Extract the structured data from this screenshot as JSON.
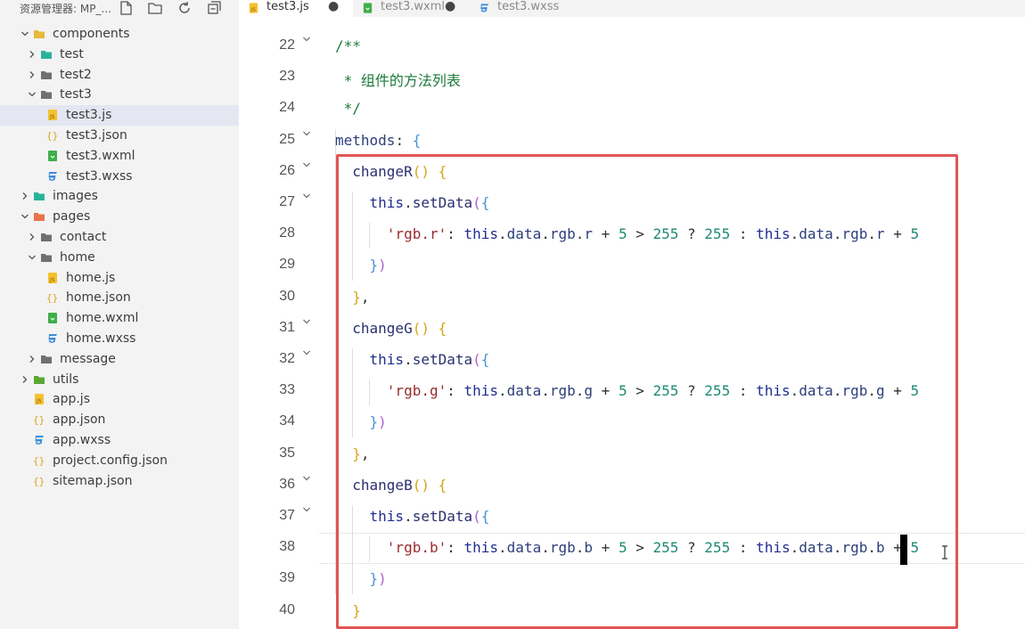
{
  "sidebar": {
    "title": "资源管理器: MP_...",
    "header_icons": [
      "new-file-icon",
      "new-folder-icon",
      "refresh-icon",
      "collapse-all-icon"
    ],
    "tree": [
      {
        "label": "components",
        "depth": 0,
        "type": "folder",
        "open": true,
        "color": "#e8b93b"
      },
      {
        "label": "test",
        "depth": 1,
        "type": "folder",
        "open": false,
        "color": "#2bb39a"
      },
      {
        "label": "test2",
        "depth": 1,
        "type": "folder",
        "open": false,
        "color": "#707070"
      },
      {
        "label": "test3",
        "depth": 1,
        "type": "folder",
        "open": true,
        "color": "#707070"
      },
      {
        "label": "test3.js",
        "depth": 2,
        "type": "js",
        "selected": true
      },
      {
        "label": "test3.json",
        "depth": 2,
        "type": "json"
      },
      {
        "label": "test3.wxml",
        "depth": 2,
        "type": "wxml"
      },
      {
        "label": "test3.wxss",
        "depth": 2,
        "type": "wxss"
      },
      {
        "label": "images",
        "depth": 0,
        "type": "folder",
        "open": false,
        "color": "#2bb39a"
      },
      {
        "label": "pages",
        "depth": 0,
        "type": "folder",
        "open": true,
        "color": "#e8734a"
      },
      {
        "label": "contact",
        "depth": 1,
        "type": "folder",
        "open": false,
        "color": "#707070"
      },
      {
        "label": "home",
        "depth": 1,
        "type": "folder",
        "open": true,
        "color": "#707070"
      },
      {
        "label": "home.js",
        "depth": 2,
        "type": "js"
      },
      {
        "label": "home.json",
        "depth": 2,
        "type": "json"
      },
      {
        "label": "home.wxml",
        "depth": 2,
        "type": "wxml"
      },
      {
        "label": "home.wxss",
        "depth": 2,
        "type": "wxss"
      },
      {
        "label": "message",
        "depth": 1,
        "type": "folder",
        "open": false,
        "color": "#707070"
      },
      {
        "label": "utils",
        "depth": 0,
        "type": "folder",
        "open": false,
        "color": "#5aa832"
      },
      {
        "label": "app.js",
        "depth": 0,
        "type": "js",
        "leaf": true
      },
      {
        "label": "app.json",
        "depth": 0,
        "type": "json",
        "leaf": true
      },
      {
        "label": "app.wxss",
        "depth": 0,
        "type": "wxss",
        "leaf": true
      },
      {
        "label": "project.config.json",
        "depth": 0,
        "type": "json",
        "leaf": true
      },
      {
        "label": "sitemap.json",
        "depth": 0,
        "type": "json",
        "leaf": true
      }
    ]
  },
  "tabs": [
    {
      "label": "test3.js",
      "type": "js",
      "active": true,
      "dirty": true
    },
    {
      "label": "test3.wxml",
      "type": "wxml",
      "active": false,
      "dirty": true
    },
    {
      "label": "test3.wxss",
      "type": "wxss",
      "active": false,
      "dirty": false
    }
  ],
  "editor": {
    "current_line": 38,
    "highlight_color": "#e05555",
    "lines": [
      {
        "n": "22",
        "fold": true,
        "tokens": [
          [
            "c",
            "/**"
          ]
        ]
      },
      {
        "n": "23",
        "fold": false,
        "tokens": [
          [
            "c",
            " * 组件的方法列表"
          ]
        ]
      },
      {
        "n": "24",
        "fold": false,
        "tokens": [
          [
            "c",
            " */"
          ]
        ]
      },
      {
        "n": "25",
        "fold": true,
        "tokens": [
          [
            "p",
            "methods"
          ],
          [
            "o",
            ": "
          ],
          [
            "b3",
            "{"
          ]
        ]
      },
      {
        "n": "26",
        "fold": true,
        "tokens": [
          [
            "o",
            "  "
          ],
          [
            "m",
            "changeR"
          ],
          [
            "b1",
            "()"
          ],
          [
            "o",
            " "
          ],
          [
            "b1",
            "{"
          ]
        ]
      },
      {
        "n": "27",
        "fold": true,
        "tokens": [
          [
            "o",
            "    "
          ],
          [
            "k",
            "this"
          ],
          [
            "o",
            "."
          ],
          [
            "m",
            "setData"
          ],
          [
            "b2",
            "("
          ],
          [
            "b3",
            "{"
          ]
        ]
      },
      {
        "n": "28",
        "fold": false,
        "tokens": [
          [
            "o",
            "      "
          ],
          [
            "s",
            "'rgb.r'"
          ],
          [
            "o",
            ": "
          ],
          [
            "k",
            "this"
          ],
          [
            "o",
            "."
          ],
          [
            "p",
            "data"
          ],
          [
            "o",
            "."
          ],
          [
            "p",
            "rgb"
          ],
          [
            "o",
            "."
          ],
          [
            "p",
            "r"
          ],
          [
            "o",
            " + "
          ],
          [
            "n",
            "5"
          ],
          [
            "o",
            " > "
          ],
          [
            "n",
            "255"
          ],
          [
            "o",
            " ? "
          ],
          [
            "n",
            "255"
          ],
          [
            "o",
            " : "
          ],
          [
            "k",
            "this"
          ],
          [
            "o",
            "."
          ],
          [
            "p",
            "data"
          ],
          [
            "o",
            "."
          ],
          [
            "p",
            "rgb"
          ],
          [
            "o",
            "."
          ],
          [
            "p",
            "r"
          ],
          [
            "o",
            " + "
          ],
          [
            "n",
            "5"
          ]
        ]
      },
      {
        "n": "29",
        "fold": false,
        "tokens": [
          [
            "o",
            "    "
          ],
          [
            "b3",
            "}"
          ],
          [
            "b2",
            ")"
          ]
        ]
      },
      {
        "n": "30",
        "fold": false,
        "tokens": [
          [
            "o",
            "  "
          ],
          [
            "b1",
            "}"
          ],
          [
            "o",
            ","
          ]
        ]
      },
      {
        "n": "31",
        "fold": true,
        "tokens": [
          [
            "o",
            "  "
          ],
          [
            "m",
            "changeG"
          ],
          [
            "b1",
            "()"
          ],
          [
            "o",
            " "
          ],
          [
            "b1",
            "{"
          ]
        ]
      },
      {
        "n": "32",
        "fold": true,
        "tokens": [
          [
            "o",
            "    "
          ],
          [
            "k",
            "this"
          ],
          [
            "o",
            "."
          ],
          [
            "m",
            "setData"
          ],
          [
            "b2",
            "("
          ],
          [
            "b3",
            "{"
          ]
        ]
      },
      {
        "n": "33",
        "fold": false,
        "tokens": [
          [
            "o",
            "      "
          ],
          [
            "s",
            "'rgb.g'"
          ],
          [
            "o",
            ": "
          ],
          [
            "k",
            "this"
          ],
          [
            "o",
            "."
          ],
          [
            "p",
            "data"
          ],
          [
            "o",
            "."
          ],
          [
            "p",
            "rgb"
          ],
          [
            "o",
            "."
          ],
          [
            "p",
            "g"
          ],
          [
            "o",
            " + "
          ],
          [
            "n",
            "5"
          ],
          [
            "o",
            " > "
          ],
          [
            "n",
            "255"
          ],
          [
            "o",
            " ? "
          ],
          [
            "n",
            "255"
          ],
          [
            "o",
            " : "
          ],
          [
            "k",
            "this"
          ],
          [
            "o",
            "."
          ],
          [
            "p",
            "data"
          ],
          [
            "o",
            "."
          ],
          [
            "p",
            "rgb"
          ],
          [
            "o",
            "."
          ],
          [
            "p",
            "g"
          ],
          [
            "o",
            " + "
          ],
          [
            "n",
            "5"
          ]
        ]
      },
      {
        "n": "34",
        "fold": false,
        "tokens": [
          [
            "o",
            "    "
          ],
          [
            "b3",
            "}"
          ],
          [
            "b2",
            ")"
          ]
        ]
      },
      {
        "n": "35",
        "fold": false,
        "tokens": [
          [
            "o",
            "  "
          ],
          [
            "b1",
            "}"
          ],
          [
            "o",
            ","
          ]
        ]
      },
      {
        "n": "36",
        "fold": true,
        "tokens": [
          [
            "o",
            "  "
          ],
          [
            "m",
            "changeB"
          ],
          [
            "b1",
            "()"
          ],
          [
            "o",
            " "
          ],
          [
            "b1",
            "{"
          ]
        ]
      },
      {
        "n": "37",
        "fold": true,
        "tokens": [
          [
            "o",
            "    "
          ],
          [
            "k",
            "this"
          ],
          [
            "o",
            "."
          ],
          [
            "m",
            "setData"
          ],
          [
            "b2",
            "("
          ],
          [
            "b3",
            "{"
          ]
        ]
      },
      {
        "n": "38",
        "fold": false,
        "tokens": [
          [
            "o",
            "      "
          ],
          [
            "s",
            "'rgb.b'"
          ],
          [
            "o",
            ": "
          ],
          [
            "k",
            "this"
          ],
          [
            "o",
            "."
          ],
          [
            "p",
            "data"
          ],
          [
            "o",
            "."
          ],
          [
            "p",
            "rgb"
          ],
          [
            "o",
            "."
          ],
          [
            "p",
            "b"
          ],
          [
            "o",
            " + "
          ],
          [
            "n",
            "5"
          ],
          [
            "o",
            " > "
          ],
          [
            "n",
            "255"
          ],
          [
            "o",
            " ? "
          ],
          [
            "n",
            "255"
          ],
          [
            "o",
            " : "
          ],
          [
            "k",
            "this"
          ],
          [
            "o",
            "."
          ],
          [
            "p",
            "data"
          ],
          [
            "o",
            "."
          ],
          [
            "p",
            "rgb"
          ],
          [
            "o",
            "."
          ],
          [
            "p",
            "b"
          ],
          [
            "o",
            " + "
          ],
          [
            "n",
            "5"
          ]
        ]
      },
      {
        "n": "39",
        "fold": false,
        "tokens": [
          [
            "o",
            "    "
          ],
          [
            "b3",
            "}"
          ],
          [
            "b2",
            ")"
          ]
        ]
      },
      {
        "n": "40",
        "fold": false,
        "tokens": [
          [
            "o",
            "  "
          ],
          [
            "b1",
            "}"
          ]
        ]
      }
    ]
  }
}
